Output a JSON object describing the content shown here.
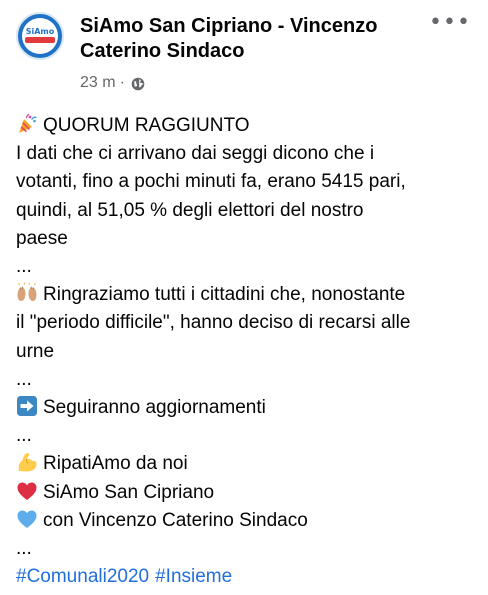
{
  "post": {
    "author": "SiAmo San Cipriano - Vincenzo Caterino Sindaco",
    "avatar_text": "SiAmo",
    "timestamp": "23 m",
    "separator": "·",
    "privacy_icon": "globe-icon",
    "more_label": "•••"
  },
  "body": {
    "line1": "QUORUM RAGGIUNTO",
    "line1_icon": "party-popper-icon",
    "para1_line1": "I dati che ci arrivano dai seggi dicono che i",
    "para1_line2": "votanti, fino a pochi minuti fa, erano 5415 pari,",
    "para1_line3": "quindi, al 51,05 % degli elettori del nostro",
    "para1_line4": "paese",
    "ellipsis1": "...",
    "para2_icon": "raising-hands-icon",
    "para2_line1": "Ringraziamo tutti i cittadini che, nonostante",
    "para2_line2": "il \"periodo difficile\", hanno deciso di recarsi alle",
    "para2_line3": "urne",
    "ellipsis2": "...",
    "para3_icon": "right-arrow-icon",
    "para3_line1": "Seguiranno aggiornamenti",
    "ellipsis3": "...",
    "sign1_icon": "flexed-biceps-icon",
    "sign1": "RipatiAmo da noi",
    "sign2_icon": "red-heart-icon",
    "sign2": "SiAmo San Cipriano",
    "sign3_icon": "blue-heart-icon",
    "sign3": "con Vincenzo Caterino Sindaco",
    "ellipsis4": "...",
    "hashtags": [
      "#Comunali2020",
      "#Insieme"
    ]
  },
  "colors": {
    "text": "#050505",
    "meta": "#65676b",
    "hashtag": "#216fdb",
    "avatar_brand": "#1f72c6"
  }
}
